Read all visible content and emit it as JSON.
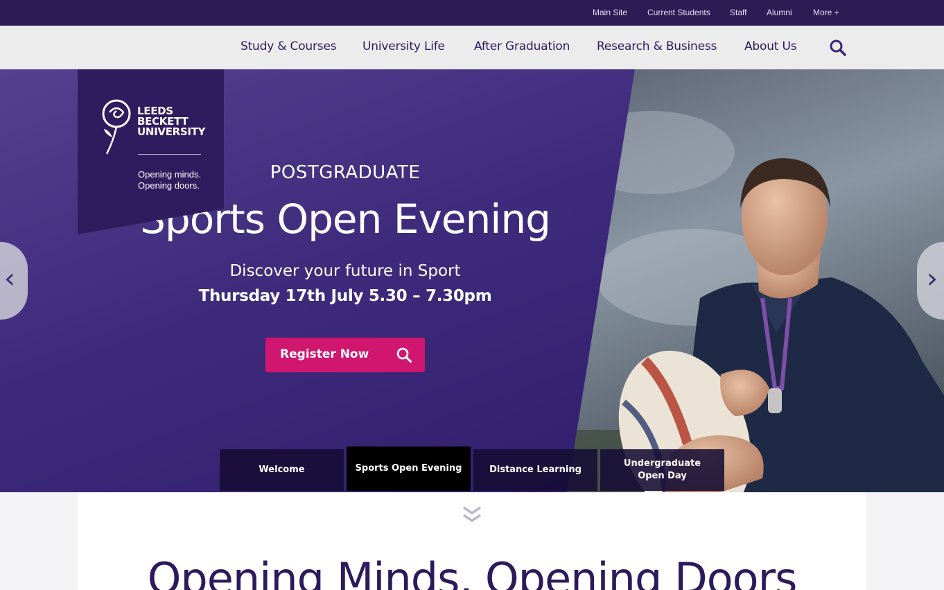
{
  "utility_nav": {
    "items": [
      {
        "label": "Main Site"
      },
      {
        "label": "Current Students"
      },
      {
        "label": "Staff"
      },
      {
        "label": "Alumni"
      },
      {
        "label": "More +"
      }
    ]
  },
  "logo": {
    "name_lines": [
      "LEEDS",
      "BECKETT",
      "UNIVERSITY"
    ],
    "tagline_lines": [
      "Opening minds.",
      "Opening doors."
    ]
  },
  "main_nav": {
    "items": [
      {
        "label": "Study & Courses"
      },
      {
        "label": "University Life"
      },
      {
        "label": "After Graduation"
      },
      {
        "label": "Research & Business"
      },
      {
        "label": "About Us"
      }
    ],
    "search_icon": "search-icon"
  },
  "hero": {
    "kicker": "POSTGRADUATE",
    "title": "Sports Open Evening",
    "subtitle": "Discover your future in Sport",
    "date": "Thursday 17th July 5.30 – 7.30pm",
    "button_label": "Register Now",
    "prev_glyph": "‹",
    "next_glyph": "›"
  },
  "slider_tabs": [
    {
      "label_lines": [
        "Welcome"
      ],
      "active": false
    },
    {
      "label_lines": [
        "Sports Open Evening"
      ],
      "active": true
    },
    {
      "label_lines": [
        "Distance Learning"
      ],
      "active": false
    },
    {
      "label_lines": [
        "Undergraduate",
        "Open Day"
      ],
      "active": false
    }
  ],
  "section": {
    "title": "Opening Minds, Opening Doors"
  },
  "colors": {
    "brand_purple": "#2d1b55",
    "nav_text": "#2c1a5c",
    "cta_pink": "#d0166e"
  }
}
